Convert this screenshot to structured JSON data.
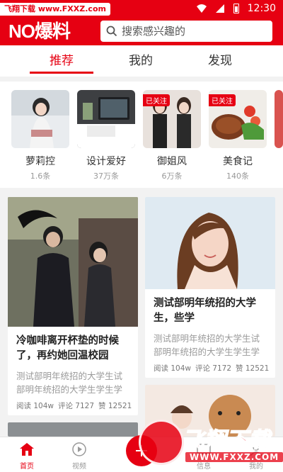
{
  "status_bar": {
    "site_watermark": "飞翔下载 www.FXXZ.com",
    "time": "12:30"
  },
  "header": {
    "logo": "NO爆料",
    "search_placeholder": "搜索感兴趣的"
  },
  "tabs": [
    {
      "label": "推荐",
      "active": true
    },
    {
      "label": "我的",
      "active": false
    },
    {
      "label": "发现",
      "active": false
    }
  ],
  "channels": [
    {
      "name": "萝莉控",
      "count": "1.6条",
      "badge": ""
    },
    {
      "name": "设计爱好",
      "count": "37万条",
      "badge": ""
    },
    {
      "name": "御姐风",
      "count": "6万条",
      "badge": "已关注"
    },
    {
      "name": "美食记",
      "count": "140条",
      "badge": "已关注"
    }
  ],
  "feed": {
    "left_card": {
      "title": "冷咖啡离开杯垫的时候了，再约她回温校园",
      "desc": "测试部明年统招的大学生试部明年统招的大学生学生学",
      "reads": "阅读 104w",
      "comments": "评论 7127",
      "likes": "赞 12521"
    },
    "right_card": {
      "title": "测试部明年统招的大学生，些学",
      "desc": "测试部明年统招的大学生试部明年统招的大学生学生学",
      "reads": "阅读 104w",
      "comments": "评论 7172",
      "likes": "赞 12521"
    }
  },
  "bottom_nav": [
    {
      "label": "首页",
      "active": true,
      "icon": "home-icon"
    },
    {
      "label": "视频",
      "active": false,
      "icon": "play-icon"
    },
    {
      "label": "信息",
      "active": false,
      "icon": "message-icon"
    },
    {
      "label": "我的",
      "active": false,
      "icon": "user-icon"
    }
  ],
  "bottom_watermark": {
    "text": "飞翔下载",
    "url": "WWW.FXXZ.COM"
  },
  "colors": {
    "accent": "#e60012",
    "background": "#f2f2f2",
    "muted_text": "#999999"
  }
}
